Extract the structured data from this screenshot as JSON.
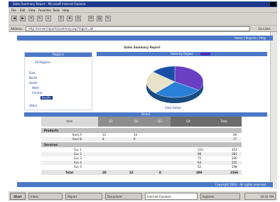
{
  "window": {
    "title": "Sales Summary Report - Microsoft Internet Explorer",
    "menu": [
      "File",
      "Edit",
      "View",
      "Favorites",
      "Tools",
      "Help"
    ]
  },
  "toolbar": {
    "buttons": [
      "back-icon",
      "forward-icon",
      "stop-icon",
      "refresh-icon",
      "home-icon",
      "search-icon",
      "favorites-icon",
      "history-icon",
      "mail-icon",
      "print-icon",
      "edit-icon"
    ]
  },
  "address": {
    "label": "Address",
    "url": "http://server/reports/summary.asp?region=all",
    "go_label": "Go  Links"
  },
  "page": {
    "top_band_text": "Home | Reports | Help",
    "report_title": "Sales Summary Report",
    "left_panel": {
      "header": "Regions",
      "items": [
        "All Regions",
        "East",
        "North",
        "South",
        "West",
        "Central",
        "Pacific",
        "Other"
      ],
      "selected_index": 6
    },
    "chart_panel": {
      "header": "Sales by Region",
      "caption": "View Detail"
    },
    "table": {
      "header": "Detail",
      "columns": [
        "Item",
        "Q1",
        "Q2",
        "Q3",
        "Q4",
        "Total"
      ],
      "section1": "Products",
      "rows1": [
        {
          "name": "Item A",
          "q1": "12",
          "q2": "14",
          "total": "26"
        },
        {
          "name": "Item B",
          "q1": "8",
          "q2": "9",
          "total": "17"
        }
      ],
      "section2": "Services",
      "rows2": [
        {
          "name": "Svc 1",
          "q4": "110",
          "total": "452"
        },
        {
          "name": "Svc 2",
          "q4": "98",
          "total": "381"
        },
        {
          "name": "Svc 3",
          "q4": "75",
          "total": "290"
        },
        {
          "name": "Svc 4",
          "q4": "64",
          "total": "245"
        },
        {
          "name": "Svc 5",
          "q4": "52",
          "total": "198"
        }
      ],
      "total_row": {
        "name": "Total",
        "q1": "20",
        "q2": "23",
        "q3": "0",
        "q4": "399",
        "total": "1566"
      }
    },
    "bottom_band_text": "Copyright 2003 - All rights reserved"
  },
  "chart_data": {
    "type": "pie",
    "title": "Sales by Region",
    "categories": [
      "Region 1",
      "Region 2",
      "Region 3",
      "Region 4"
    ],
    "values": [
      34,
      28,
      24,
      14
    ],
    "colors": [
      "#6a3fc4",
      "#2a7fd6",
      "#e8e3c8",
      "#1a4fa8"
    ]
  },
  "taskbar": {
    "start_label": "Start",
    "items": [
      "Inbox",
      "Report",
      "Document",
      "Internet Explorer",
      "Explorer"
    ],
    "active_index": 3,
    "clock": "10:42 AM"
  }
}
